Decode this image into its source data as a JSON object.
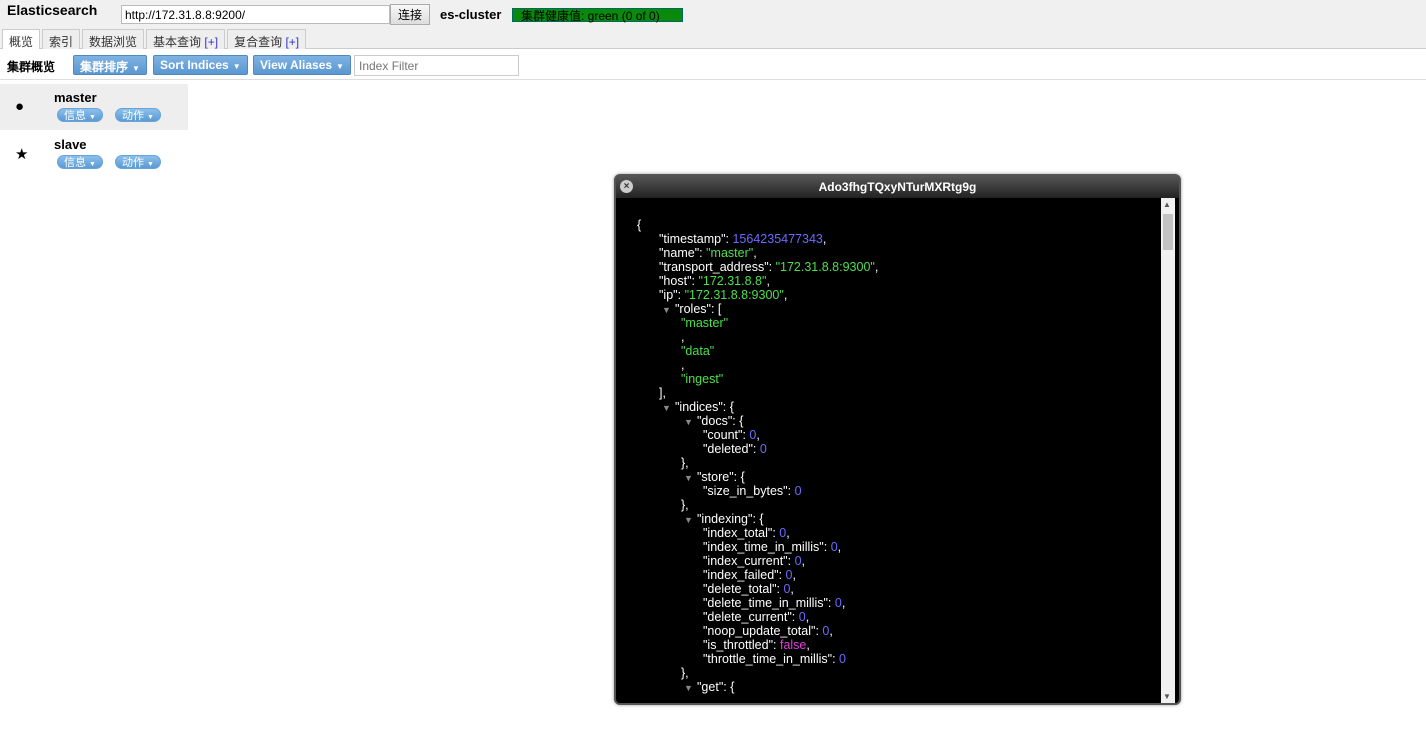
{
  "header": {
    "brand": "Elasticsearch",
    "url": "http://172.31.8.8:9200/",
    "connect_label": "连接",
    "cluster_name": "es-cluster",
    "health": "集群健康值: green (0 of 0)",
    "health_color": "#0a8a0a"
  },
  "tabs": [
    {
      "label": "概览",
      "plus": ""
    },
    {
      "label": "索引",
      "plus": ""
    },
    {
      "label": "数据浏览",
      "plus": ""
    },
    {
      "label": "基本查询",
      "plus": "[+]"
    },
    {
      "label": "复合查询",
      "plus": "[+]"
    }
  ],
  "toolbar": {
    "title": "集群概览",
    "sort_cluster": "集群排序",
    "sort_indices": "Sort Indices",
    "view_aliases": "View Aliases",
    "filter_placeholder": "Index Filter"
  },
  "nodes": [
    {
      "name": "master",
      "icon": "●",
      "info": "信息",
      "action": "动作"
    },
    {
      "name": "slave",
      "icon": "★",
      "info": "信息",
      "action": "动作"
    }
  ],
  "dialog": {
    "title": "Ado3fhgTQxyNTurMXRtg9g",
    "close": "×",
    "lines": [
      {
        "i": 0,
        "t": "{"
      },
      {
        "i": 1,
        "k": "timestamp",
        "v": "1564235477343",
        "vt": "num",
        "s": ","
      },
      {
        "i": 1,
        "k": "name",
        "v": "\"master\"",
        "vt": "str",
        "s": ","
      },
      {
        "i": 1,
        "k": "transport_address",
        "v": "\"172.31.8.8:9300\"",
        "vt": "str",
        "s": ","
      },
      {
        "i": 1,
        "k": "host",
        "v": "\"172.31.8.8\"",
        "vt": "str",
        "s": ","
      },
      {
        "i": 1,
        "k": "ip",
        "v": "\"172.31.8.8:9300\"",
        "vt": "str",
        "s": ","
      },
      {
        "i": 1,
        "a": true,
        "k": "roles",
        "t2": "["
      },
      {
        "i": 2,
        "v": "\"master\"",
        "vt": "str"
      },
      {
        "i": 2,
        "t": ","
      },
      {
        "i": 2,
        "v": "\"data\"",
        "vt": "str"
      },
      {
        "i": 2,
        "t": ","
      },
      {
        "i": 2,
        "v": "\"ingest\"",
        "vt": "str"
      },
      {
        "i": 1,
        "t": "],"
      },
      {
        "i": 1,
        "a": true,
        "k": "indices",
        "t2": "{"
      },
      {
        "i": 2,
        "a": true,
        "k": "docs",
        "t2": "{"
      },
      {
        "i": 3,
        "k": "count",
        "v": "0",
        "vt": "num",
        "s": ","
      },
      {
        "i": 3,
        "k": "deleted",
        "v": "0",
        "vt": "num"
      },
      {
        "i": 2,
        "t": "},"
      },
      {
        "i": 2,
        "a": true,
        "k": "store",
        "t2": "{"
      },
      {
        "i": 3,
        "k": "size_in_bytes",
        "v": "0",
        "vt": "num"
      },
      {
        "i": 2,
        "t": "},"
      },
      {
        "i": 2,
        "a": true,
        "k": "indexing",
        "t2": "{"
      },
      {
        "i": 3,
        "k": "index_total",
        "v": "0",
        "vt": "num",
        "s": ","
      },
      {
        "i": 3,
        "k": "index_time_in_millis",
        "v": "0",
        "vt": "num",
        "s": ","
      },
      {
        "i": 3,
        "k": "index_current",
        "v": "0",
        "vt": "num",
        "s": ","
      },
      {
        "i": 3,
        "k": "index_failed",
        "v": "0",
        "vt": "num",
        "s": ","
      },
      {
        "i": 3,
        "k": "delete_total",
        "v": "0",
        "vt": "num",
        "s": ","
      },
      {
        "i": 3,
        "k": "delete_time_in_millis",
        "v": "0",
        "vt": "num",
        "s": ","
      },
      {
        "i": 3,
        "k": "delete_current",
        "v": "0",
        "vt": "num",
        "s": ","
      },
      {
        "i": 3,
        "k": "noop_update_total",
        "v": "0",
        "vt": "num",
        "s": ","
      },
      {
        "i": 3,
        "k": "is_throttled",
        "v": "false",
        "vt": "bool",
        "s": ","
      },
      {
        "i": 3,
        "k": "throttle_time_in_millis",
        "v": "0",
        "vt": "num"
      },
      {
        "i": 2,
        "t": "},"
      },
      {
        "i": 2,
        "a": true,
        "k": "get",
        "t2": "{"
      }
    ]
  }
}
